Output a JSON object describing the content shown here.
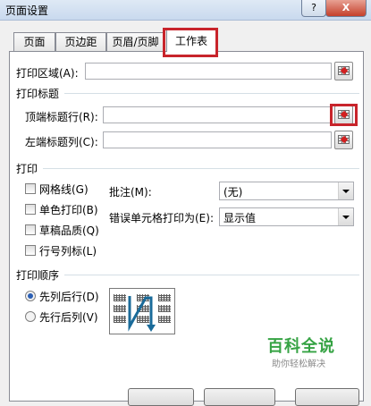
{
  "window": {
    "title": "页面设置",
    "help_label": "?",
    "close_label": "X"
  },
  "tabs": [
    {
      "label": "页面"
    },
    {
      "label": "页边距"
    },
    {
      "label": "页眉/页脚"
    },
    {
      "label": "工作表",
      "active": true
    }
  ],
  "print_area": {
    "label": "打印区域(A):",
    "value": ""
  },
  "print_titles": {
    "group_title": "打印标题",
    "rows_label": "顶端标题行(R):",
    "rows_value": "",
    "cols_label": "左端标题列(C):",
    "cols_value": ""
  },
  "print": {
    "group_title": "打印",
    "checkboxes": [
      {
        "label": "网格线(G)",
        "checked": false
      },
      {
        "label": "单色打印(B)",
        "checked": false
      },
      {
        "label": "草稿品质(Q)",
        "checked": false
      },
      {
        "label": "行号列标(L)",
        "checked": false
      }
    ],
    "comments_label": "批注(M):",
    "comments_value": "(无)",
    "errors_label": "错误单元格打印为(E):",
    "errors_value": "显示值"
  },
  "page_order": {
    "group_title": "打印顺序",
    "options": [
      {
        "label": "先列后行(D)",
        "selected": true
      },
      {
        "label": "先行后列(V)",
        "selected": false
      }
    ]
  },
  "watermark": {
    "main": "百科全说",
    "sub": "助你轻松解决"
  },
  "colors": {
    "highlight": "#c8242b",
    "watermark": "#36a344"
  }
}
